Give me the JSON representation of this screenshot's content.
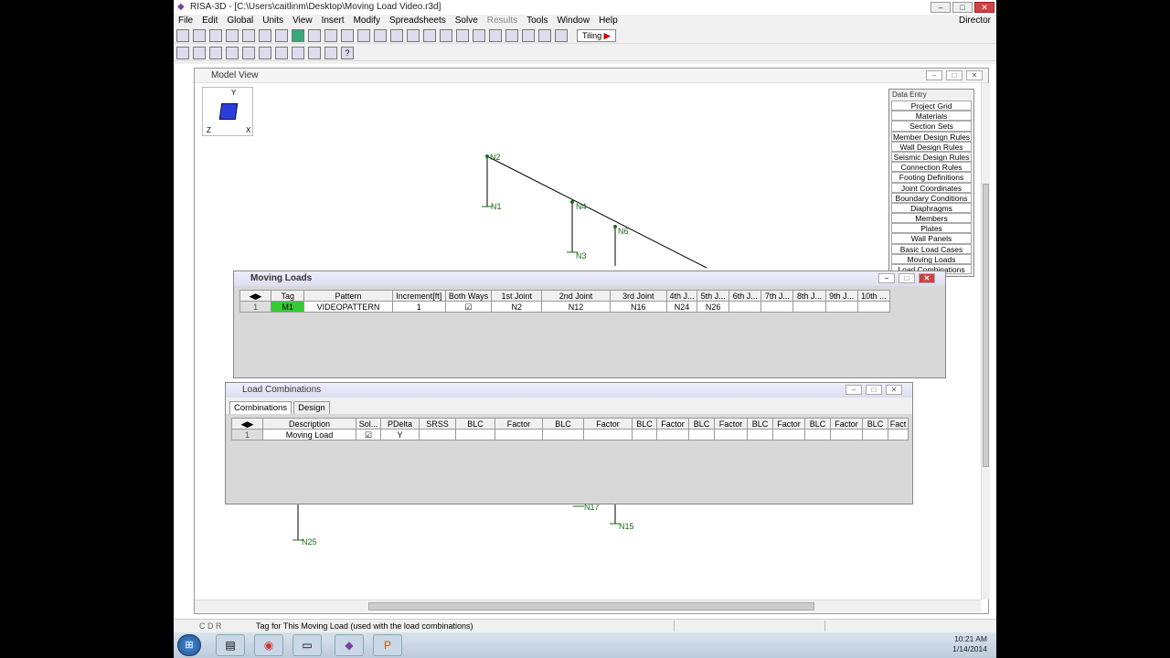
{
  "app": {
    "title": "RISA-3D - [C:\\Users\\caitlinm\\Desktop\\Moving Load Video.r3d]",
    "mode": "Director"
  },
  "menu": [
    {
      "label": "File"
    },
    {
      "label": "Edit"
    },
    {
      "label": "Global"
    },
    {
      "label": "Units"
    },
    {
      "label": "View"
    },
    {
      "label": "Insert"
    },
    {
      "label": "Modify"
    },
    {
      "label": "Spreadsheets"
    },
    {
      "label": "Solve"
    },
    {
      "label": "Results",
      "disabled": true
    },
    {
      "label": "Tools"
    },
    {
      "label": "Window"
    },
    {
      "label": "Help"
    }
  ],
  "toolbar": {
    "tiling_label": "Tiling"
  },
  "model_view": {
    "title": "Model View",
    "axes": {
      "y": "Y",
      "x": "X",
      "z": "Z"
    }
  },
  "nodes": [
    {
      "label": "N2"
    },
    {
      "label": "N1"
    },
    {
      "label": "N4"
    },
    {
      "label": "N3"
    },
    {
      "label": "N6"
    },
    {
      "label": "N17"
    },
    {
      "label": "N15"
    },
    {
      "label": "N25"
    }
  ],
  "data_entry": {
    "title": "Data Entry",
    "items": [
      "Project Grid",
      "Materials",
      "Section Sets",
      "Member Design Rules",
      "Wall Design Rules",
      "Seismic Design Rules",
      "Connection Rules",
      "Footing Definitions",
      "Joint Coordinates",
      "Boundary Conditions",
      "Diaphragms",
      "Members",
      "Plates",
      "Wall Panels",
      "Basic Load Cases",
      "Moving Loads",
      "Load Combinations"
    ]
  },
  "moving_loads": {
    "title": "Moving Loads",
    "columns": [
      "Tag",
      "Pattern",
      "Increment[ft]",
      "Both Ways",
      "1st Joint",
      "2nd Joint",
      "3rd Joint",
      "4th J...",
      "5th J...",
      "6th J...",
      "7th J...",
      "8th J...",
      "9th J...",
      "10th ..."
    ],
    "row": {
      "num": "1",
      "tag": "M1",
      "pattern": "VIDEOPATTERN",
      "increment": "1",
      "both_ways": "☑",
      "j1": "N2",
      "j2": "N12",
      "j3": "N16",
      "j4": "N24",
      "j5": "N26"
    }
  },
  "load_combinations": {
    "title": "Load Combinations",
    "tabs": [
      "Combinations",
      "Design"
    ],
    "columns": [
      "Description",
      "Sol...",
      "PDelta",
      "SRSS",
      "BLC",
      "Factor",
      "BLC",
      "Factor",
      "BLC",
      "Factor",
      "BLC",
      "Factor",
      "BLC",
      "Factor",
      "BLC",
      "Factor",
      "BLC",
      "Fact"
    ],
    "row": {
      "num": "1",
      "description": "Moving Load",
      "solve": "☑",
      "pdelta": "Y"
    }
  },
  "status": {
    "text": "Tag for This Moving Load (used with the load combinations)"
  },
  "taskbar": {
    "start": "⊞",
    "tray_time": "10:21 AM",
    "tray_date": "1/14/2014"
  }
}
